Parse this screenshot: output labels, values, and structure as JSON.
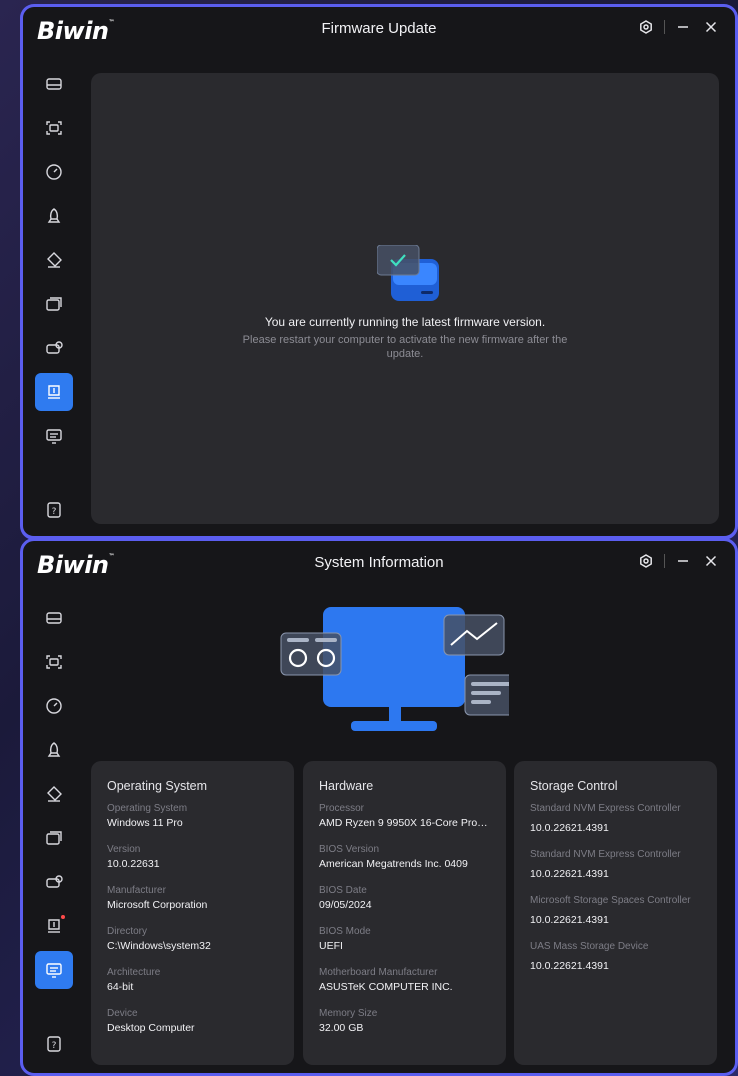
{
  "brand": "Biwin",
  "trademark": "™",
  "firmware_window": {
    "title": "Firmware Update",
    "message_primary": "You are currently running the latest firmware version.",
    "message_secondary": "Please restart your computer to activate the new firmware after the update."
  },
  "sysinfo_window": {
    "title": "System Information",
    "operating_system": {
      "heading": "Operating System",
      "fields": [
        {
          "label": "Operating System",
          "value": "Windows 11 Pro"
        },
        {
          "label": "Version",
          "value": "10.0.22631"
        },
        {
          "label": "Manufacturer",
          "value": "Microsoft Corporation"
        },
        {
          "label": "Directory",
          "value": "C:\\Windows\\system32"
        },
        {
          "label": "Architecture",
          "value": "64-bit"
        },
        {
          "label": "Device",
          "value": "Desktop Computer"
        }
      ]
    },
    "hardware": {
      "heading": "Hardware",
      "fields": [
        {
          "label": "Processor",
          "value": "AMD Ryzen 9 9950X 16-Core Proces..."
        },
        {
          "label": "BIOS Version",
          "value": "American Megatrends Inc. 0409"
        },
        {
          "label": "BIOS Date",
          "value": "09/05/2024"
        },
        {
          "label": "BIOS Mode",
          "value": "UEFI"
        },
        {
          "label": "Motherboard Manufacturer",
          "value": "ASUSTeK COMPUTER INC."
        },
        {
          "label": "Memory Size",
          "value": "32.00 GB"
        }
      ]
    },
    "storage_control": {
      "heading": "Storage Control",
      "fields": [
        {
          "label": "Standard NVM Express Controller",
          "value": "10.0.22621.4391"
        },
        {
          "label": "Standard NVM Express Controller",
          "value": "10.0.22621.4391"
        },
        {
          "label": "Microsoft Storage Spaces Controller",
          "value": "10.0.22621.4391"
        },
        {
          "label": "UAS Mass Storage Device",
          "value": "10.0.22621.4391"
        }
      ]
    }
  },
  "sidebar_icons": [
    "drive-icon",
    "scan-icon",
    "speedometer-icon",
    "rocket-icon",
    "eraser-icon",
    "clone-icon",
    "drive-sync-icon",
    "firmware-icon",
    "system-info-icon",
    "help-icon"
  ],
  "colors": {
    "accent": "#2f7bf0",
    "frame": "#5b5ef0",
    "panel": "#2a2a2e",
    "background": "#161619",
    "alert_dot": "#ff4a4a"
  }
}
